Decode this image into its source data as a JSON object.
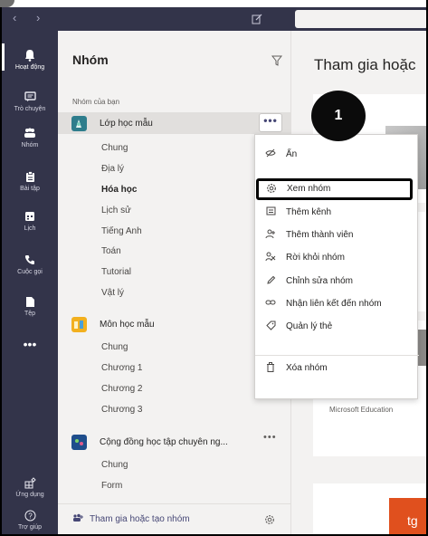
{
  "titlebar": {
    "back_icon": "chevron-left-icon",
    "forward_icon": "chevron-right-icon",
    "compose_icon": "compose-icon"
  },
  "rail": {
    "items": [
      {
        "label": "Hoạt động",
        "icon": "bell-icon"
      },
      {
        "label": "Trò chuyện",
        "icon": "chat-icon"
      },
      {
        "label": "Nhóm",
        "icon": "teams-icon"
      },
      {
        "label": "Bài tập",
        "icon": "assignment-icon"
      },
      {
        "label": "Lịch",
        "icon": "calendar-icon"
      },
      {
        "label": "Cuộc gọi",
        "icon": "phone-icon"
      },
      {
        "label": "Tệp",
        "icon": "file-icon"
      }
    ],
    "more": "•••",
    "bottom": [
      {
        "label": "Ứng dụng",
        "icon": "apps-icon"
      },
      {
        "label": "Trợ giúp",
        "icon": "help-icon"
      }
    ]
  },
  "panel": {
    "title": "Nhóm",
    "section_label": "Nhóm của bạn",
    "teams": [
      {
        "name": "Lớp học mẫu",
        "color": "#2e7d8c",
        "channels": [
          "Chung",
          "Địa lý",
          "Hóa học",
          "Lịch sử",
          "Tiếng Anh",
          "Toán",
          "Tutorial",
          "Vật lý"
        ],
        "bold_channel": "Hóa học"
      },
      {
        "name": "Môn học mẫu",
        "color": "#f2b01e",
        "channels": [
          "Chung",
          "Chương 1",
          "Chương 2",
          "Chương 3"
        ]
      },
      {
        "name": "Cộng đồng học tập chuyên ng...",
        "color": "#1f4e8c",
        "channels": [
          "Chung",
          "Form"
        ]
      }
    ],
    "more_label": "•••",
    "footer": {
      "join_label": "Tham gia hoặc tạo nhóm"
    }
  },
  "main": {
    "title": "Tham gia hoặc",
    "ms_education": "Microsoft Education",
    "tg_button": "tg"
  },
  "badge": {
    "label": "1"
  },
  "context_menu": {
    "items": [
      {
        "label": "Ẩn",
        "icon": "hide-icon"
      },
      {
        "label": "Xem nhóm",
        "icon": "gear-icon"
      },
      {
        "label": "Thêm kênh",
        "icon": "channel-icon"
      },
      {
        "label": "Thêm thành viên",
        "icon": "add-member-icon"
      },
      {
        "label": "Rời khỏi nhóm",
        "icon": "leave-icon"
      },
      {
        "label": "Chỉnh sửa nhóm",
        "icon": "pencil-icon"
      },
      {
        "label": "Nhận liên kết đến nhóm",
        "icon": "link-icon"
      },
      {
        "label": "Quản lý thẻ",
        "icon": "tag-icon"
      },
      {
        "label": "Xóa nhóm",
        "icon": "trash-icon"
      }
    ]
  },
  "colors": {
    "rail": "#33344a",
    "panel": "#f3f2f1",
    "accent": "#464775",
    "cta": "#e0501e"
  }
}
